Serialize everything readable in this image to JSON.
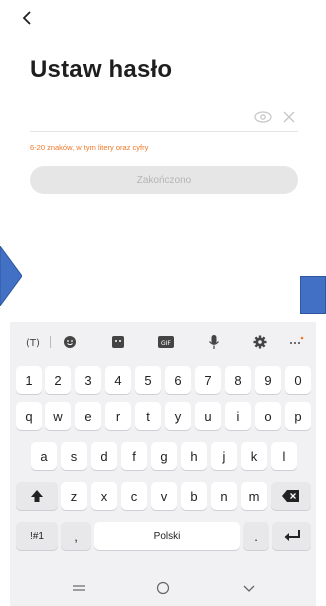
{
  "header": {
    "back_icon": "chevron-left-icon",
    "title": "Ustaw hasło"
  },
  "password": {
    "value": "",
    "placeholder": "",
    "show_icon": "eye-icon",
    "clear_icon": "close-icon",
    "hint": "6-20 znaków, w tym litery oraz cyfry"
  },
  "done_button": {
    "label": "Zakończono",
    "enabled": false
  },
  "keyboard": {
    "toolbar_icons": [
      "translate-icon",
      "emoji-icon",
      "sticker-icon",
      "gif-icon",
      "microphone-icon",
      "settings-icon",
      "more-icon"
    ],
    "row_numbers": [
      "1",
      "2",
      "3",
      "4",
      "5",
      "6",
      "7",
      "8",
      "9",
      "0"
    ],
    "row_1": [
      "q",
      "w",
      "e",
      "r",
      "t",
      "y",
      "u",
      "i",
      "o",
      "p"
    ],
    "row_2": [
      "a",
      "s",
      "d",
      "f",
      "g",
      "h",
      "j",
      "k",
      "l"
    ],
    "row_3": [
      "z",
      "x",
      "c",
      "v",
      "b",
      "n",
      "m"
    ],
    "symbols_label": "!#1",
    "comma_label": ",",
    "space_label": "Polski",
    "period_label": ".",
    "shift_icon": "shift-icon",
    "backspace_icon": "backspace-icon",
    "enter_icon": "enter-icon"
  },
  "navbar": {
    "icons": [
      "recent-apps-icon",
      "home-icon",
      "back-icon"
    ]
  },
  "colors": {
    "hint": "#f07828",
    "button_bg": "#e6e6e6",
    "button_text": "#b5b5b5",
    "keyboard_bg": "#f1f1f3",
    "deco_blue": "#4170c4"
  }
}
